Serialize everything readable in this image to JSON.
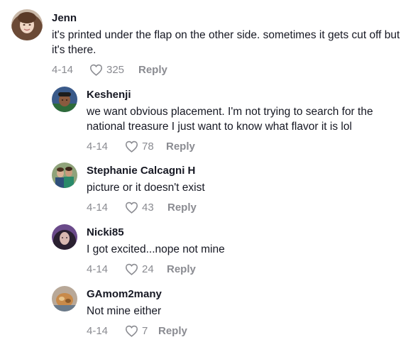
{
  "comments": [
    {
      "username": "Jenn",
      "text": "it's printed under the flap on the other side. sometimes it gets cut off but it's there.",
      "date": "4-14",
      "likes": "325",
      "reply_label": "Reply",
      "avatar_icon": "user-avatar-icon"
    }
  ],
  "replies": [
    {
      "username": "Keshenji",
      "text": "we want obvious placement. I'm not trying to search for the national treasure I just want to know what flavor it is lol",
      "date": "4-14",
      "likes": "78",
      "reply_label": "Reply",
      "avatar_icon": "user-avatar-icon"
    },
    {
      "username": "Stephanie Calcagni H",
      "text": "picture or it doesn't exist",
      "date": "4-14",
      "likes": "43",
      "reply_label": "Reply",
      "avatar_icon": "user-avatar-icon"
    },
    {
      "username": "Nicki85",
      "text": "I got excited...nope not mine",
      "date": "4-14",
      "likes": "24",
      "reply_label": "Reply",
      "avatar_icon": "user-avatar-icon"
    },
    {
      "username": "GAmom2many",
      "text": "Not mine either",
      "date": "4-14",
      "likes": "7",
      "reply_label": "Reply",
      "avatar_icon": "user-avatar-icon"
    }
  ],
  "colors": {
    "text": "#161823",
    "meta": "#8a8b91",
    "background": "#ffffff"
  },
  "icons": {
    "like": "heart-outline-icon"
  }
}
